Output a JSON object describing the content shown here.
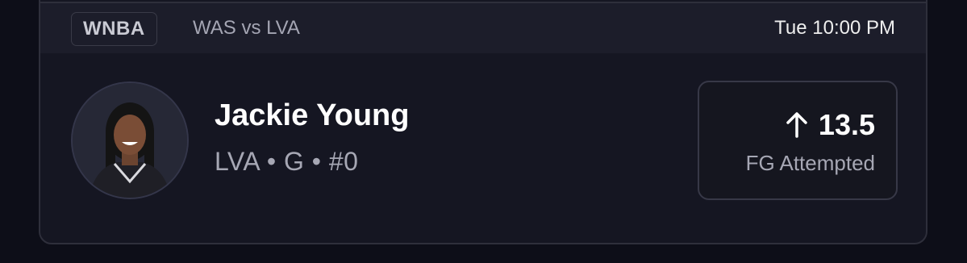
{
  "header": {
    "league": "WNBA",
    "matchup": "WAS vs LVA",
    "time": "Tue 10:00 PM"
  },
  "player": {
    "name": "Jackie Young",
    "meta": "LVA • G • #0",
    "avatar_icon": "player-photo"
  },
  "prop": {
    "direction_icon": "arrow-up-icon",
    "line": "13.5",
    "stat": "FG Attempted"
  },
  "colors": {
    "background": "#0d0e18",
    "card": "#151622",
    "header": "#1c1d2a",
    "muted_text": "#a6a7b4"
  }
}
